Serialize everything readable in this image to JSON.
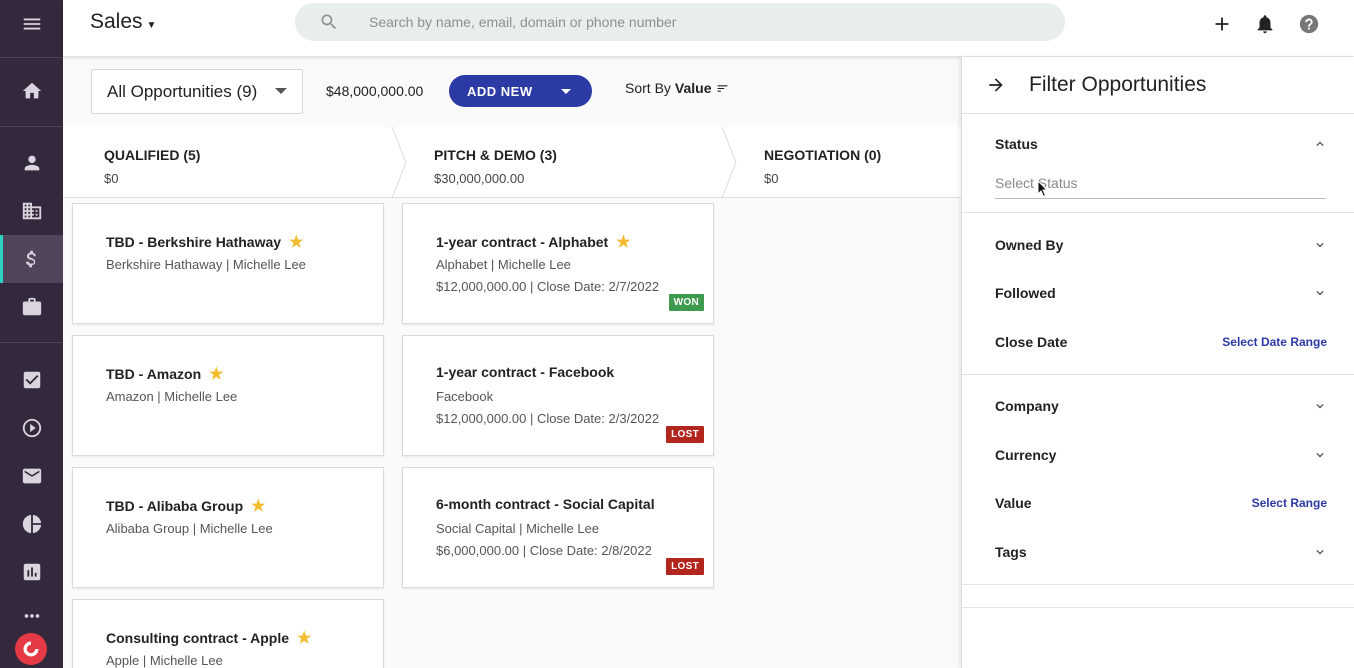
{
  "app": {
    "title": "Sales"
  },
  "search": {
    "placeholder": "Search by name, email, domain or phone number"
  },
  "toolbar": {
    "view_label": "All Opportunities (9)",
    "total_value": "$48,000,000.00",
    "add_new_label": "ADD NEW",
    "sort_prefix": "Sort By",
    "sort_value": "Value"
  },
  "stages": [
    {
      "name": "QUALIFIED (5)",
      "amount": "$0"
    },
    {
      "name": "PITCH & DEMO (3)",
      "amount": "$30,000,000.00"
    },
    {
      "name": "NEGOTIATION (0)",
      "amount": "$0"
    }
  ],
  "qualified_cards": [
    {
      "title": "TBD - Berkshire Hathaway",
      "sub": "Berkshire Hathaway | Michelle Lee"
    },
    {
      "title": "TBD - Amazon",
      "sub": "Amazon | Michelle Lee"
    },
    {
      "title": "TBD - Alibaba Group",
      "sub": "Alibaba Group | Michelle Lee"
    },
    {
      "title": "Consulting contract - Apple",
      "sub": "Apple | Michelle Lee"
    }
  ],
  "pitch_cards": [
    {
      "title": "1-year contract - Alphabet",
      "sub": "Alphabet | Michelle Lee",
      "sub2": "$12,000,000.00 | Close Date: 2/7/2022",
      "badge": "WON"
    },
    {
      "title": "1-year contract - Facebook",
      "sub": "Facebook",
      "sub2": "$12,000,000.00 | Close Date: 2/3/2022",
      "badge": "LOST"
    },
    {
      "title": "6-month contract - Social Capital",
      "sub": "Social Capital | Michelle Lee",
      "sub2": "$6,000,000.00 | Close Date: 2/8/2022",
      "badge": "LOST"
    }
  ],
  "filter_panel": {
    "title": "Filter Opportunities",
    "status_label": "Status",
    "status_placeholder": "Select Status",
    "owned_by": "Owned By",
    "followed": "Followed",
    "close_date": "Close Date",
    "close_date_link": "Select Date Range",
    "company": "Company",
    "currency": "Currency",
    "value": "Value",
    "value_link": "Select Range",
    "tags": "Tags"
  },
  "colors": {
    "rail_bg": "#34283c",
    "accent": "#2c3aa6",
    "star": "#f2bc2e",
    "won": "#3d9a4f",
    "lost": "#b3261e",
    "active_marker": "#2dd4bf"
  }
}
